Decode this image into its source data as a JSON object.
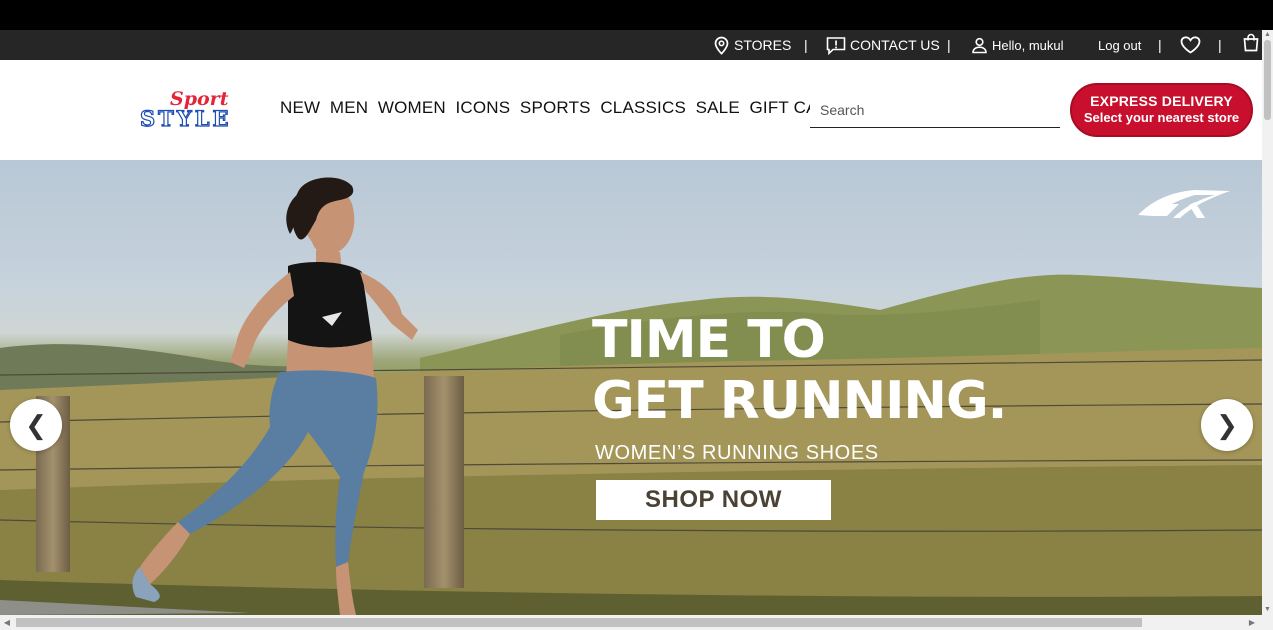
{
  "utility_bar": {
    "stores": "STORES",
    "contact_us": "CONTACT US",
    "greeting": "Hello, mukul",
    "logout": "Log out",
    "separator": "|"
  },
  "logo": {
    "line1": "Sport",
    "line2": "STYLE"
  },
  "nav": [
    "NEW",
    "MEN",
    "WOMEN",
    "ICONS",
    "SPORTS",
    "CLASSICS",
    "SALE",
    "GIFT CARD"
  ],
  "search": {
    "placeholder": "Search",
    "value": ""
  },
  "express": {
    "line1": "EXPRESS DELIVERY",
    "line2": "Select your nearest store"
  },
  "hero": {
    "headline_line1": "TIME TO",
    "headline_line2": "GET RUNNING.",
    "subheading": "WOMEN’S RUNNING SHOES",
    "cta": "SHOP NOW",
    "prev": "❮",
    "next": "❯"
  },
  "icons": [
    "location-pin-icon",
    "contact-message-icon",
    "user-icon",
    "heart-icon",
    "shopping-bag-icon",
    "reebok-logo"
  ],
  "colors": {
    "utility_bg": "#262626",
    "express_red": "#c8102e",
    "logo_red": "#e3253a",
    "logo_blue": "#1f4db3",
    "cta_text": "#4b4134"
  }
}
